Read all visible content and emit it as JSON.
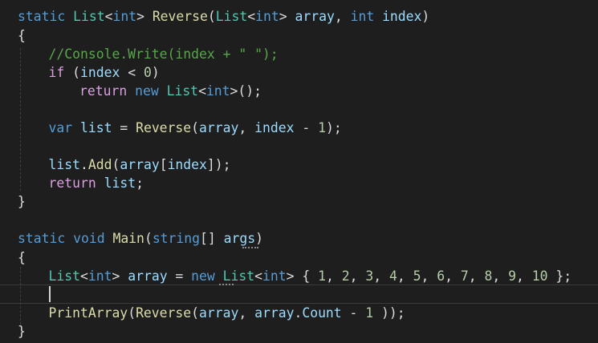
{
  "editor": {
    "lines": {
      "l1": "static List<int> Reverse(List<int> array, int index)",
      "l2": "{",
      "l3": "//Console.Write(index + \" \");",
      "l4": "if (index < 0)",
      "l5": "return new List<int>();",
      "l6": "var list = Reverse(array, index - 1);",
      "l7": "list.Add(array[index]);",
      "l8": "return list;",
      "l9": "}",
      "l10": "static void Main(string[] args)",
      "l11": "{",
      "l12": "List<int> array = new List<int> { 1, 2, 3, 4, 5, 6, 7, 8, 9, 10 };",
      "l13": "PrintArray(Reverse(array, array.Count - 1 ));",
      "l14": "}"
    },
    "colors": {
      "background": "#1e1e1e",
      "keyword": "#569cd6",
      "type": "#4ec9b0",
      "method": "#dcdcaa",
      "parameter": "#9cdcfe",
      "control": "#d8a0df",
      "comment": "#57a64a",
      "number": "#b5cea8"
    }
  }
}
